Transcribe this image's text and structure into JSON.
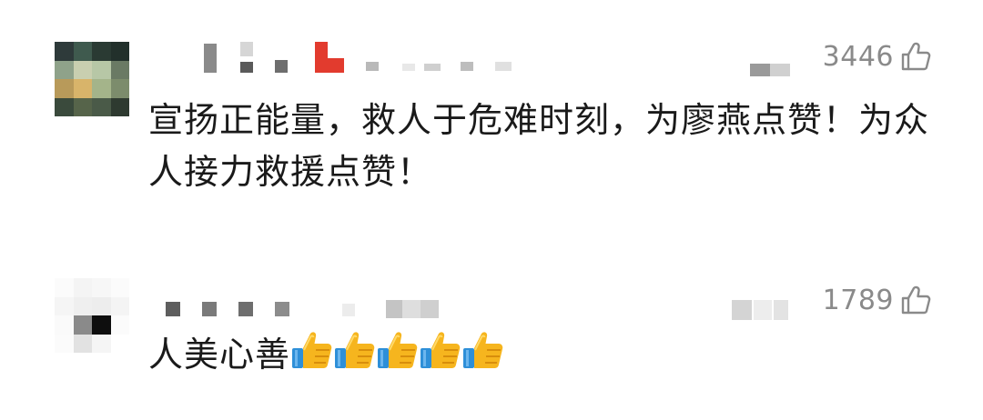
{
  "comments": [
    {
      "likes": "3446",
      "text": "宣扬正能量，救人于危难时刻，为廖燕点赞！为众人接力救援点赞！",
      "emojis": []
    },
    {
      "likes": "1789",
      "text": "人美心善",
      "emojis": [
        "thumbs-up",
        "thumbs-up",
        "thumbs-up",
        "thumbs-up",
        "thumbs-up"
      ]
    }
  ],
  "icons": {
    "like": "thumbs-up-outline-icon",
    "emoji": "thumbs-up-emoji-icon"
  },
  "colors": {
    "text": "#1a1a1a",
    "meta": "#8a8a8a",
    "emoji_yellow": "#f6b51e",
    "emoji_cuff": "#2e8fd8",
    "mosaic_red": "#e23b2e"
  }
}
